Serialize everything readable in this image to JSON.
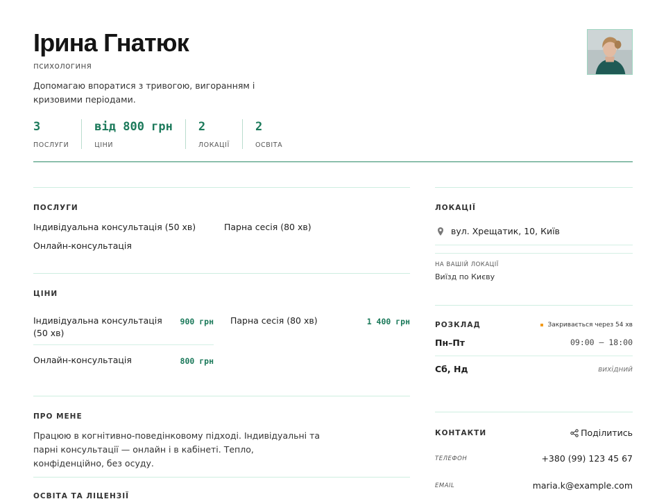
{
  "profile": {
    "name": "Ірина Гнатюк",
    "role": "психологиня",
    "bio": "Допомагаю впоратися з тривогою, вигоранням і кризовими періодами."
  },
  "stats": [
    {
      "value": "3",
      "label": "ПОСЛУГИ"
    },
    {
      "value": "від 800 грн",
      "label": "ЦІНИ"
    },
    {
      "value": "2",
      "label": "ЛОКАЦІЇ"
    },
    {
      "value": "2",
      "label": "ОСВІТА"
    }
  ],
  "services": {
    "title": "ПОСЛУГИ",
    "items": [
      "Індивідуальна консультація (50 хв)",
      "Парна сесія (80 хв)",
      "Онлайн-консультація"
    ]
  },
  "prices": {
    "title": "ЦІНИ",
    "items": [
      {
        "name": "Індивідуальна консультація (50 хв)",
        "price": "900 грн"
      },
      {
        "name": "Парна сесія (80 хв)",
        "price": "1 400 грн"
      },
      {
        "name": "Онлайн-консультація",
        "price": "800 грн"
      }
    ]
  },
  "about": {
    "title": "ПРО МЕНЕ",
    "text": "Працюю в когнітивно-поведінковому підході. Індивідуальні та парні консультації — онлайн і в кабінеті. Тепло, конфіденційно, без осуду."
  },
  "education": {
    "title": "ОСВІТА ТА ЛІЦЕНЗІЇ"
  },
  "locations": {
    "title": "ЛОКАЦІЇ",
    "address": "вул. Хрещатик, 10, Київ",
    "sub_label": "НА ВАШІЙ ЛОКАЦІЇ",
    "sub_value": "Виїзд по Києву",
    "pin_icon": "map-pin-icon"
  },
  "schedule": {
    "title": "РОЗКЛАД",
    "status": "Закривається через 54 хв",
    "status_color": "#f29b1e",
    "rows": [
      {
        "days": "Пн–Пт",
        "hours": "09:00 – 18:00"
      },
      {
        "days": "Сб, Нд",
        "hours": "вихідний"
      }
    ]
  },
  "contacts": {
    "title": "КОНТАКТИ",
    "share_label": "Поділитись",
    "share_icon": "share-icon",
    "rows": [
      {
        "label": "ТЕЛЕФОН",
        "value": "+380 (99) 123 45 67"
      },
      {
        "label": "EMAIL",
        "value": "maria.k@example.com"
      }
    ]
  },
  "colors": {
    "accent": "#1c7a5b",
    "rule": "#2c8a66",
    "divider": "#cdeee0"
  }
}
